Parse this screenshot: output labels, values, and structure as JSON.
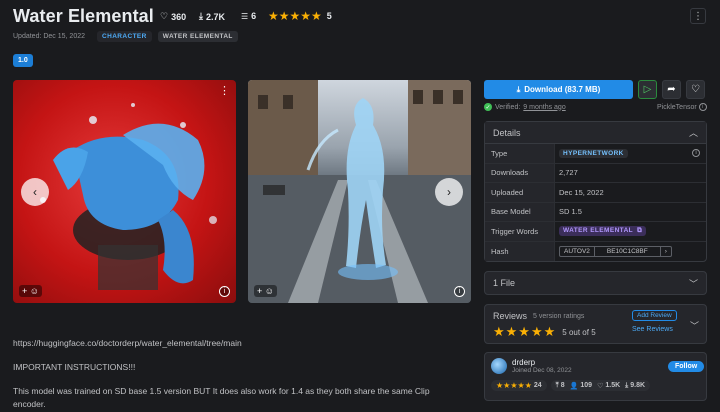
{
  "header": {
    "title": "Water Elemental",
    "likes": "360",
    "downloads": "2.7K",
    "comments": "6",
    "rating_count": "5",
    "rating_stars": "★★★★★"
  },
  "meta": {
    "updated": "Updated: Dec 15, 2022",
    "type_badge": "CHARACTER",
    "tag_badge": "WATER ELEMENTAL"
  },
  "version": "1.0",
  "gallery": {
    "prev": "‹",
    "next": "›"
  },
  "description": {
    "link": "https://huggingface.co/doctorderp/water_elemental/tree/main",
    "heading": "IMPORTANT INSTRUCTIONS!!!",
    "line1": "This model was trained on SD base 1.5 version BUT It does also work for 1.4 as they both share the same Clip",
    "line2": "encoder."
  },
  "actions": {
    "download_label": "Download (83.7 MB)",
    "verified_prefix": "Verified:",
    "verified_time": "9 months ago",
    "provider": "PickleTensor"
  },
  "details": {
    "title": "Details",
    "rows": {
      "type_key": "Type",
      "type_val": "HYPERNETWORK",
      "downloads_key": "Downloads",
      "downloads_val": "2,727",
      "uploaded_key": "Uploaded",
      "uploaded_val": "Dec 15, 2022",
      "base_key": "Base Model",
      "base_val": "SD 1.5",
      "trigger_key": "Trigger Words",
      "trigger_val": "WATER ELEMENTAL",
      "hash_key": "Hash",
      "hash_algo": "AUTOV2",
      "hash_val": "BE10C1C8BF"
    }
  },
  "files": {
    "label": "1 File"
  },
  "reviews": {
    "title": "Reviews",
    "count": "5 version ratings",
    "stars": "★★★★★",
    "summary": "5 out of 5",
    "add_label": "Add Review",
    "see_label": "See Reviews"
  },
  "creator": {
    "name": "drderp",
    "joined": "Joined Dec 08, 2022",
    "follow_label": "Follow",
    "stars": "★★★★★",
    "rating": "24",
    "uploads": "8",
    "followers": "109",
    "favorites": "1.5K",
    "downloads": "9.8K"
  },
  "colors": {
    "accent": "#228be6",
    "star": "#fab005",
    "bg": "#1a1b1e",
    "panel": "#25262b"
  }
}
